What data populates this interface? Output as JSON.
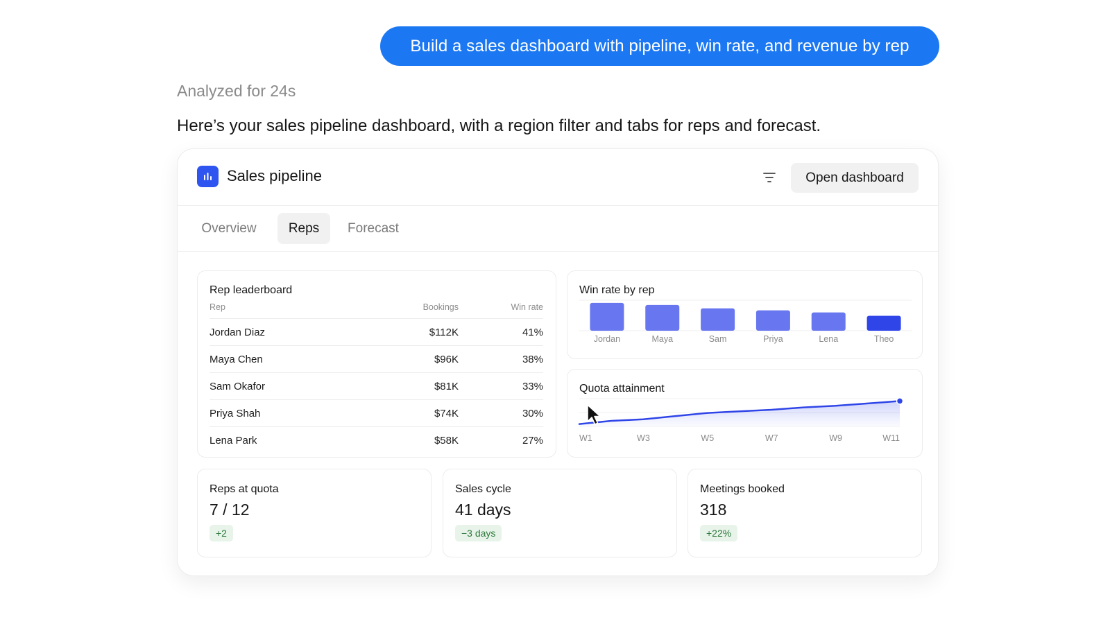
{
  "chat": {
    "user_message": "Build a sales dashboard with pipeline, win rate, and revenue by rep",
    "analyzed_label": "Analyzed for 24s",
    "assistant_reply": "Here’s your sales pipeline dashboard, with a region filter and tabs for reps and forecast."
  },
  "dashboard": {
    "title": "Sales pipeline",
    "open_button": "Open dashboard",
    "accent_color": "#2f55f0",
    "tabs": [
      {
        "label": "Overview",
        "active": false
      },
      {
        "label": "Reps",
        "active": true
      },
      {
        "label": "Forecast",
        "active": false
      }
    ],
    "leaderboard": {
      "title": "Rep leaderboard",
      "columns": [
        "Rep",
        "Bookings",
        "Win rate"
      ],
      "rows": [
        {
          "rep": "Jordan Diaz",
          "bookings": "$112K",
          "win_rate": "41%"
        },
        {
          "rep": "Maya Chen",
          "bookings": "$96K",
          "win_rate": "38%"
        },
        {
          "rep": "Sam Okafor",
          "bookings": "$81K",
          "win_rate": "33%"
        },
        {
          "rep": "Priya Shah",
          "bookings": "$74K",
          "win_rate": "30%"
        },
        {
          "rep": "Lena Park",
          "bookings": "$58K",
          "win_rate": "27%"
        }
      ]
    },
    "stats": [
      {
        "label": "Reps at quota",
        "value": "7 / 12",
        "delta": "+2"
      },
      {
        "label": "Sales cycle",
        "value": "41 days",
        "delta": "−3 days"
      },
      {
        "label": "Meetings booked",
        "value": "318",
        "delta": "+22%"
      }
    ]
  },
  "chart_data": [
    {
      "type": "bar",
      "title": "Win rate by rep",
      "categories": [
        "Jordan",
        "Maya",
        "Sam",
        "Priya",
        "Lena",
        "Theo"
      ],
      "values": [
        41,
        38,
        33,
        30,
        27,
        22
      ],
      "ylim": [
        0,
        45
      ],
      "grid": true,
      "colors": {
        "bar": "#6877ef",
        "highlight": "#2f45e8"
      }
    },
    {
      "type": "area",
      "title": "Quota attainment",
      "x": [
        "W1",
        "W2",
        "W3",
        "W4",
        "W5",
        "W6",
        "W7",
        "W8",
        "W9",
        "W10",
        "W11"
      ],
      "tick_labels": [
        "W1",
        "W3",
        "W5",
        "W7",
        "W9",
        "W11"
      ],
      "values": [
        58,
        62,
        64,
        68,
        72,
        74,
        76,
        79,
        81,
        84,
        87
      ],
      "ylim": [
        55,
        90
      ],
      "grid": true,
      "colors": {
        "line": "#2f45e8"
      }
    }
  ]
}
